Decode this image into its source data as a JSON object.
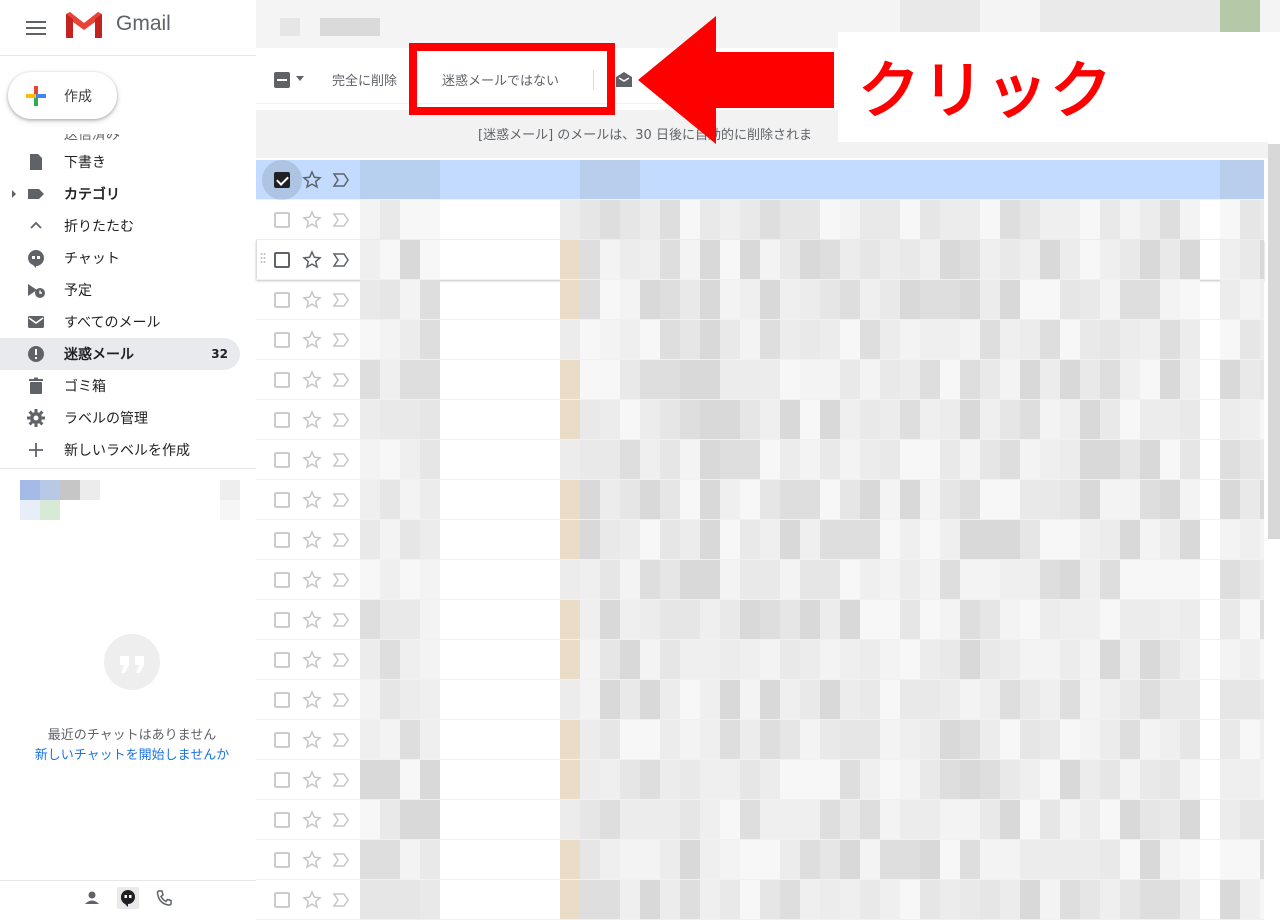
{
  "app": {
    "name": "Gmail"
  },
  "compose": {
    "label": "作成"
  },
  "sidebar": {
    "partial_item": "送信済み",
    "items": [
      {
        "label": "下書き",
        "icon": "draft-icon",
        "bold": false,
        "active": false,
        "count": ""
      },
      {
        "label": "カテゴリ",
        "icon": "label-icon",
        "bold": true,
        "active": false,
        "count": ""
      },
      {
        "label": "折りたたむ",
        "icon": "chevron-up-icon",
        "bold": false,
        "active": false,
        "count": ""
      },
      {
        "label": "チャット",
        "icon": "chat-icon",
        "bold": false,
        "active": false,
        "count": ""
      },
      {
        "label": "予定",
        "icon": "scheduled-icon",
        "bold": false,
        "active": false,
        "count": ""
      },
      {
        "label": "すべてのメール",
        "icon": "mail-icon",
        "bold": false,
        "active": false,
        "count": ""
      },
      {
        "label": "迷惑メール",
        "icon": "spam-icon",
        "bold": true,
        "active": true,
        "count": "32"
      },
      {
        "label": "ゴミ箱",
        "icon": "trash-icon",
        "bold": false,
        "active": false,
        "count": ""
      },
      {
        "label": "ラベルの管理",
        "icon": "gear-icon",
        "bold": false,
        "active": false,
        "count": ""
      },
      {
        "label": "新しいラベルを作成",
        "icon": "plus-icon",
        "bold": false,
        "active": false,
        "count": ""
      }
    ]
  },
  "chat": {
    "empty_text": "最近のチャットはありません",
    "start_link": "新しいチャットを開始しませんか"
  },
  "toolbar": {
    "delete_forever": "完全に削除",
    "not_spam": "迷惑メールではない"
  },
  "notice": {
    "text": "[迷惑メール] のメールは、30 日後に自動的に削除されま"
  },
  "annotation": {
    "text": "クリック",
    "color": "#ff0000"
  },
  "mail_rows": {
    "count": 19,
    "selected_index": 0,
    "hover_index": 2
  },
  "colors": {
    "selected_row": "#c2dbff",
    "active_nav": "#e8eaed",
    "link": "#1a73e8"
  }
}
